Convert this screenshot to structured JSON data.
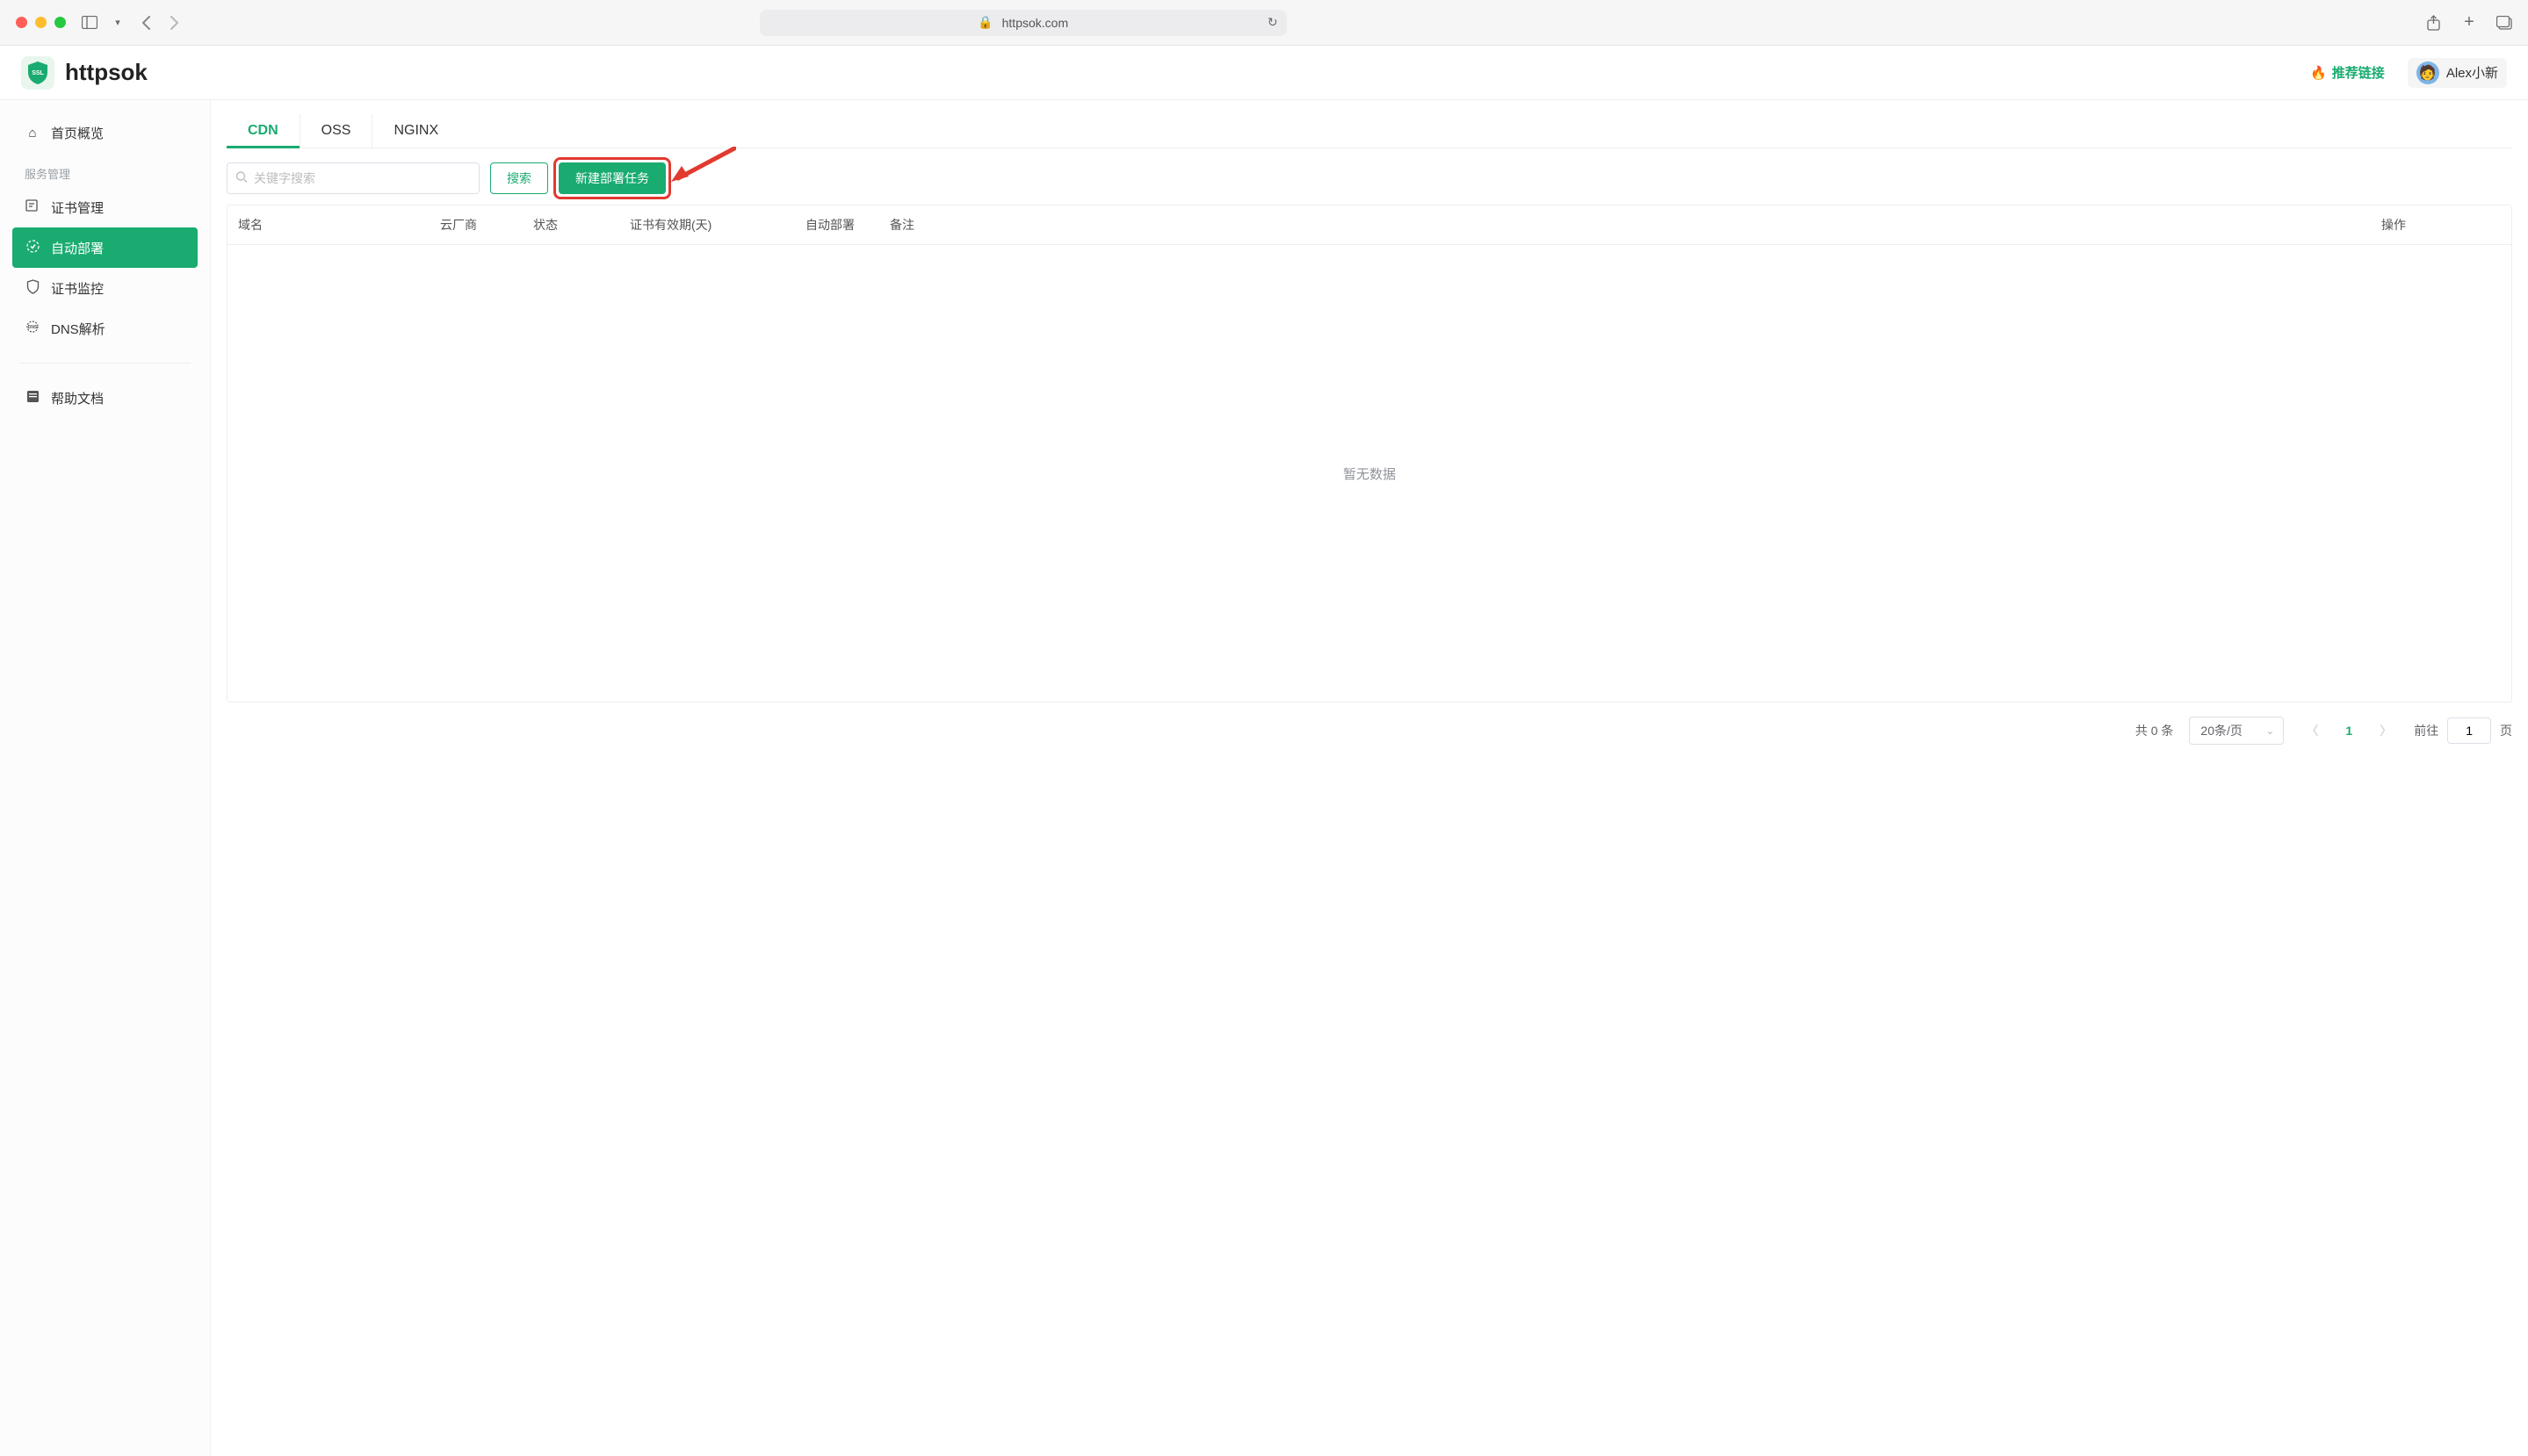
{
  "browser": {
    "url": "httpsok.com"
  },
  "app": {
    "logo_text": "httpsok",
    "logo_badge": "SSL",
    "promo_label": "推荐链接",
    "user_name": "Alex小新"
  },
  "sidebar": {
    "items": [
      {
        "label": "首页概览",
        "icon": "home"
      },
      {
        "label": "证书管理",
        "icon": "cert"
      },
      {
        "label": "自动部署",
        "icon": "deploy"
      },
      {
        "label": "证书监控",
        "icon": "monitor"
      },
      {
        "label": "DNS解析",
        "icon": "dns"
      },
      {
        "label": "帮助文档",
        "icon": "doc"
      }
    ],
    "section_label": "服务管理"
  },
  "tabs": {
    "items": [
      "CDN",
      "OSS",
      "NGINX"
    ],
    "active": "CDN"
  },
  "toolbar": {
    "search_placeholder": "关键字搜索",
    "search_button": "搜索",
    "create_button": "新建部署任务"
  },
  "table": {
    "columns": [
      "域名",
      "云厂商",
      "状态",
      "证书有效期(天)",
      "自动部署",
      "备注",
      "操作"
    ],
    "rows": [],
    "empty_text": "暂无数据"
  },
  "pagination": {
    "total_prefix": "共",
    "total_count": 0,
    "total_suffix": "条",
    "page_size_label": "20条/页",
    "current_page": 1,
    "goto_prefix": "前往",
    "goto_value": 1,
    "goto_suffix": "页"
  }
}
